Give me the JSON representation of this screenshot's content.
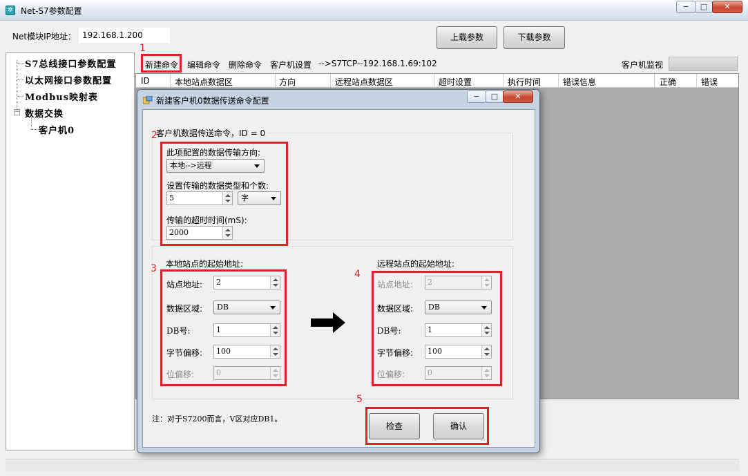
{
  "window": {
    "title": "Net-S7参数配置",
    "ip_label": "Net模块IP地址：",
    "ip_value": "192.168.1.200",
    "upload_label": "上载参数",
    "download_label": "下载参数",
    "caption": {
      "minimize": "−",
      "maximize": "□",
      "close": "✕"
    }
  },
  "tree": {
    "items": [
      "S7总线接口参数配置",
      "以太网接口参数配置",
      "Modbus映射表",
      "数据交换",
      "客户机0"
    ]
  },
  "menu": {
    "new_command": "新建命令",
    "edit_command": "编辑命令",
    "delete_command": "删除命令",
    "client_settings": "客户机设置",
    "connection": "-->S7TCP--192.168.1.69:102",
    "monitor_label": "客户机监视"
  },
  "grid": {
    "columns": [
      "ID",
      "本地站点数据区",
      "方向",
      "远程站点数据区",
      "超时设置",
      "执行时间",
      "错误信息",
      "正确",
      "错误"
    ]
  },
  "dialog": {
    "title": "新建客户机0数据传送命令配置",
    "group_title": "客户机数据传送命令，ID = 0",
    "direction_label": "此项配置的数据传输方向:",
    "direction_value": "本地-->远程",
    "type_count_label": "设置传输的数据类型和个数:",
    "count_value": "5",
    "type_value": "字",
    "timeout_label": "传输的超时时间(mS):",
    "timeout_value": "2000",
    "local": {
      "title": "本地站点的起始地址:",
      "station_label": "站点地址:",
      "station_value": "2",
      "area_label": "数据区域:",
      "area_value": "DB",
      "db_label": "DB号:",
      "db_value": "1",
      "byte_label": "字节偏移:",
      "byte_value": "100",
      "bit_label": "位偏移:",
      "bit_value": "0"
    },
    "remote": {
      "title": "远程站点的起始地址:",
      "station_label": "站点地址:",
      "station_value": "2",
      "area_label": "数据区域:",
      "area_value": "DB",
      "db_label": "DB号:",
      "db_value": "1",
      "byte_label": "字节偏移:",
      "byte_value": "100",
      "bit_label": "位偏移:",
      "bit_value": "0"
    },
    "note": "注：对于S7200而言，V区对应DB1。",
    "check_label": "检查",
    "confirm_label": "确认"
  },
  "annotations": [
    "1",
    "2",
    "3",
    "4",
    "5"
  ],
  "colors": {
    "highlight": "#d8232a",
    "grid_background": "#ababab",
    "dialog_frame": "#c6d3e2"
  }
}
